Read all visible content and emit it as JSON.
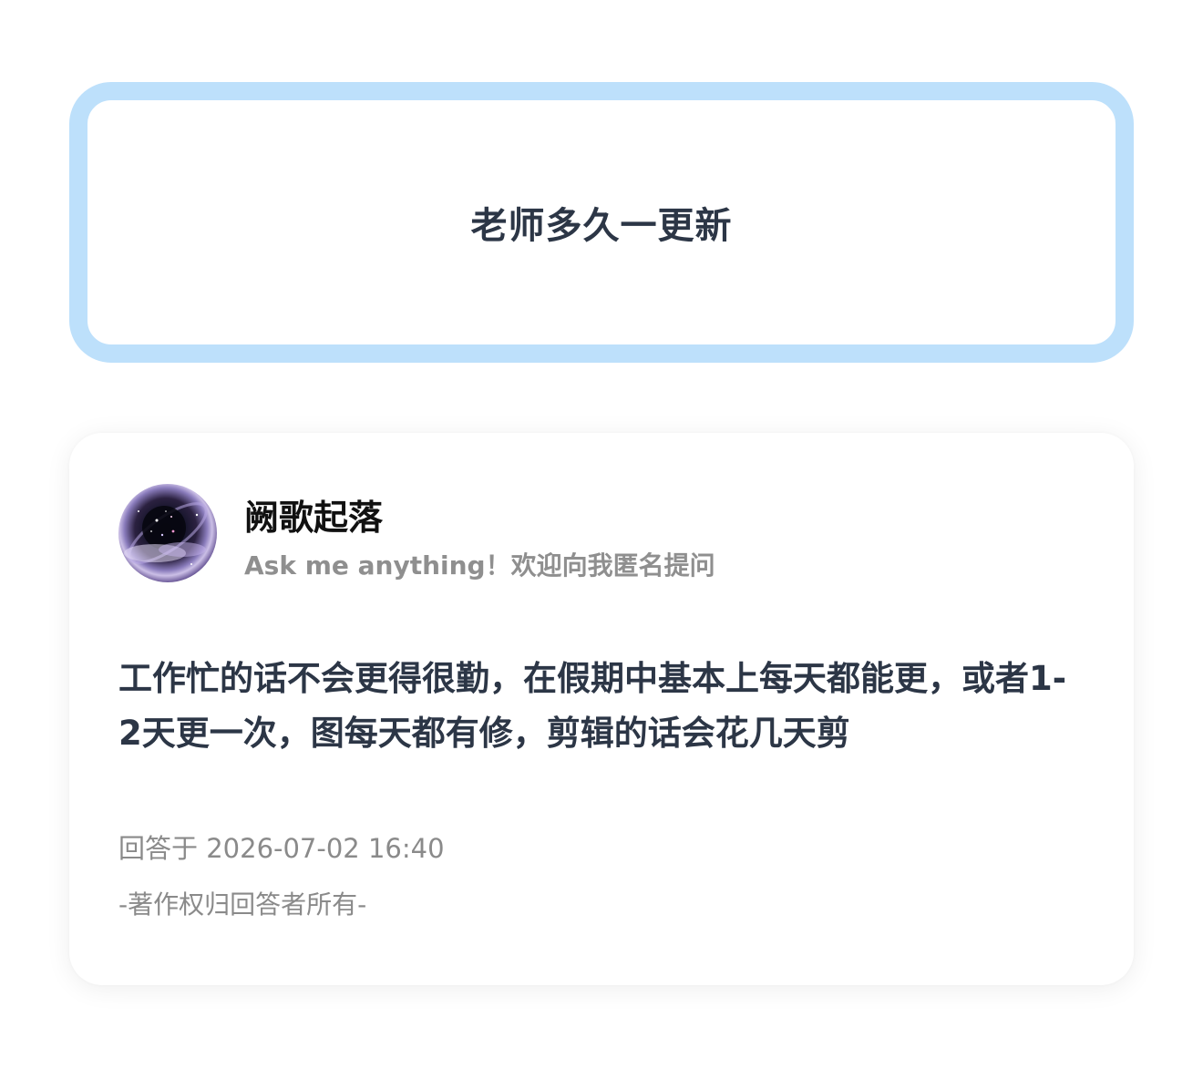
{
  "question": {
    "text": "老师多久一更新"
  },
  "answer": {
    "author_name": "阙歌起落",
    "author_tagline": "Ask me anything！欢迎向我匿名提问",
    "content": "工作忙的话不会更得很勤，在假期中基本上每天都能更，或者1-2天更一次，图每天都有修，剪辑的话会花几天剪",
    "timestamp": "回答于 2026-07-02 16:40",
    "copyright": "-著作权归回答者所有-"
  },
  "colors": {
    "question_border": "#bde0fb",
    "text_primary": "#2c3646",
    "text_secondary": "#8a8a8a"
  }
}
